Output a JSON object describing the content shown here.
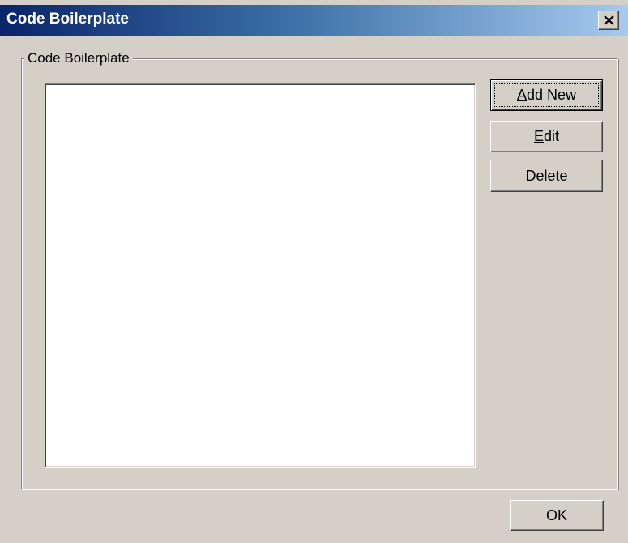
{
  "window": {
    "title": "Code Boilerplate"
  },
  "group": {
    "label": "Code Boilerplate",
    "items": []
  },
  "buttons": {
    "add_new": {
      "mnemonic": "A",
      "rest": "dd New"
    },
    "edit": {
      "mnemonic": "E",
      "rest": "dit"
    },
    "delete": {
      "pre": "D",
      "mnemonic": "e",
      "rest": "lete"
    },
    "ok": "OK"
  },
  "icons": {
    "close": "close-icon"
  },
  "colors": {
    "titlebar_start": "#0a246a",
    "titlebar_end": "#a6caf0",
    "face": "#d4d0c8"
  }
}
